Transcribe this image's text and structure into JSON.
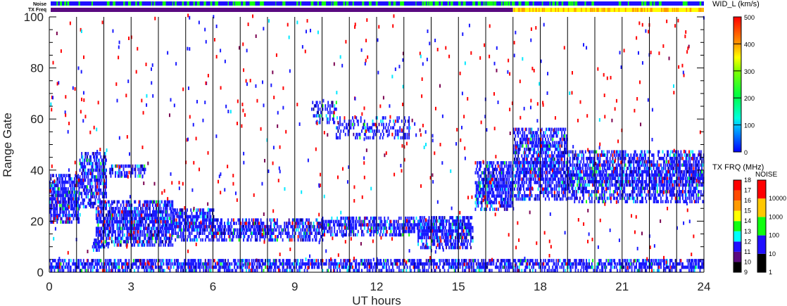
{
  "chart_data": {
    "type": "heatmap",
    "title": "",
    "xlabel": "UT hours",
    "ylabel": "Range Gate",
    "xlim": [
      0,
      24
    ],
    "ylim": [
      0,
      100
    ],
    "xticks": [
      "0",
      "3",
      "6",
      "9",
      "12",
      "15",
      "18",
      "21",
      "24"
    ],
    "yticks": [
      "0",
      "20",
      "40",
      "60",
      "80",
      "100"
    ],
    "strip_labels": {
      "noise": "Noise",
      "txfreq": "TX Freq"
    },
    "tx_freq_change_hour": 17,
    "echo_regions": [
      {
        "hours": [
          0,
          1.1
        ],
        "gates": [
          19,
          38
        ],
        "density": 0.85
      },
      {
        "hours": [
          1.1,
          2.1
        ],
        "gates": [
          25,
          46
        ],
        "density": 0.7
      },
      {
        "hours": [
          1.5,
          2.2
        ],
        "gates": [
          8,
          12
        ],
        "density": 0.6
      },
      {
        "hours": [
          1.7,
          4.5
        ],
        "gates": [
          10,
          28
        ],
        "density": 0.85
      },
      {
        "hours": [
          2.2,
          3.5
        ],
        "gates": [
          37,
          41
        ],
        "density": 0.6
      },
      {
        "hours": [
          4.5,
          6
        ],
        "gates": [
          12,
          25
        ],
        "density": 0.8
      },
      {
        "hours": [
          6,
          10
        ],
        "gates": [
          12,
          20
        ],
        "density": 0.7
      },
      {
        "hours": [
          10,
          13.5
        ],
        "gates": [
          14,
          21
        ],
        "density": 0.65
      },
      {
        "hours": [
          13.5,
          15.5
        ],
        "gates": [
          9,
          22
        ],
        "density": 0.85
      },
      {
        "hours": [
          9.6,
          10.5
        ],
        "gates": [
          58,
          66
        ],
        "density": 0.4
      },
      {
        "hours": [
          10.5,
          13.2
        ],
        "gates": [
          52,
          60
        ],
        "density": 0.35
      },
      {
        "hours": [
          15.6,
          17
        ],
        "gates": [
          24,
          43
        ],
        "density": 0.8
      },
      {
        "hours": [
          17,
          19
        ],
        "gates": [
          28,
          56
        ],
        "density": 0.75
      },
      {
        "hours": [
          19,
          24
        ],
        "gates": [
          27,
          47
        ],
        "density": 0.75
      },
      {
        "hours": [
          0,
          24
        ],
        "gates": [
          0,
          5
        ],
        "density": 0.7
      }
    ],
    "colorbars": {
      "width": {
        "label": "WID_L (km/s)",
        "ticks": [
          "0",
          "100",
          "200",
          "300",
          "400",
          "500"
        ]
      },
      "txfreq": {
        "label": "TX FRQ (MHz)",
        "ticks": [
          "9",
          "10",
          "11",
          "12",
          "13",
          "14",
          "15",
          "16",
          "17",
          "18"
        ],
        "colors": [
          "#000000",
          "#5a0a80",
          "#2010ff",
          "#00ffff",
          "#10ff10",
          "#ffff00",
          "#ff9a00",
          "#ff4a00",
          "#ff0000"
        ]
      },
      "noise": {
        "label": "NOISE",
        "ticks": [
          "1",
          "10",
          "100",
          "1000",
          "10000"
        ],
        "colors": [
          "#000000",
          "#2010ff",
          "#10ff10",
          "#ffc800",
          "#ff0000"
        ]
      }
    }
  }
}
